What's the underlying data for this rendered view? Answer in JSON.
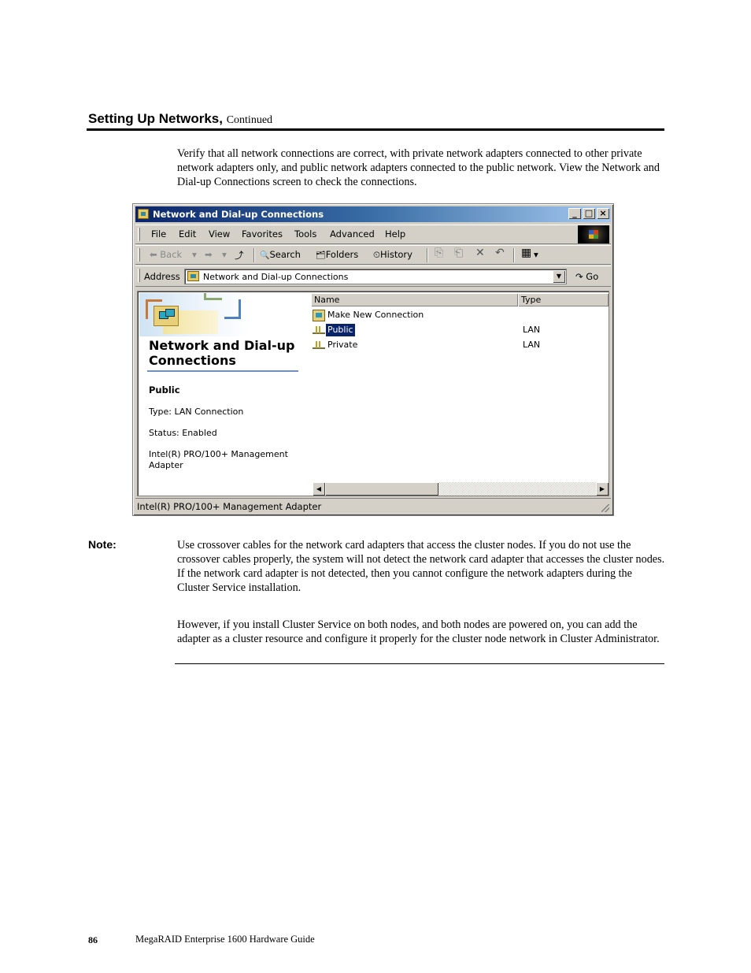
{
  "page": {
    "section_title": "Setting Up Networks,",
    "section_continued": "Continued",
    "intro_paragraph": "Verify that all network connections are correct, with private network adapters connected to other private network adapters only, and public network adapters connected to the public network. View the Network and Dial-up Connections screen to check the connections.",
    "note_label": "Note:",
    "note_paragraph_1": "Use crossover cables for the network card adapters that access the cluster nodes.  If you do not use the crossover cables properly, the system will not detect the network card adapter that accesses the cluster nodes.  If the network card adapter is not detected, then you cannot configure the network adapters during the Cluster Service installation.",
    "note_paragraph_2": "However, if you install Cluster Service on both nodes, and both nodes are powered on, you can add the adapter as a cluster resource and configure it properly for the cluster node network in Cluster Administrator.",
    "footer_page_number": "86",
    "footer_title": "MegaRAID Enterprise 1600 Hardware Guide"
  },
  "window": {
    "title": "Network and Dial-up Connections",
    "title_icon": "network-folder-icon",
    "controls": {
      "minimize": "_",
      "maximize": "□",
      "close": "×"
    },
    "menu": [
      "File",
      "Edit",
      "View",
      "Favorites",
      "Tools",
      "Advanced",
      "Help"
    ],
    "toolbar": {
      "back": "Back",
      "back_icon": "arrow-left-icon",
      "forward_icon": "arrow-right-icon",
      "up_icon": "folder-up-icon",
      "search": "Search",
      "search_icon": "magnifier-icon",
      "folders": "Folders",
      "folders_icon": "folders-icon",
      "history": "History",
      "history_icon": "clock-icon",
      "move_icon": "move-to-icon",
      "copy_icon": "copy-to-icon",
      "delete_icon": "x-icon",
      "undo_icon": "undo-icon",
      "views_icon": "views-icon",
      "dropdown_glyph": "▾",
      "back_glyph": "⬅",
      "forward_glyph": "➡",
      "up_glyph": "⤴",
      "search_glyph": "🔍",
      "folders_glyph": "🗂",
      "history_glyph": "⏲",
      "move_glyph": "⎘",
      "copy_glyph": "⎗",
      "delete_glyph": "✕",
      "undo_glyph": "↶",
      "views_glyph": "▦"
    },
    "address": {
      "label": "Address",
      "value": "Network and Dial-up Connections",
      "dropdown_glyph": "▼",
      "go_label": "Go",
      "go_glyph": "↷"
    },
    "left_pane": {
      "heading": "Network and Dial-up Connections",
      "selected_name": "Public",
      "type_line": "Type: LAN Connection",
      "status_line": "Status: Enabled",
      "adapter_line": "Intel(R) PRO/100+ Management Adapter"
    },
    "list": {
      "columns": [
        "Name",
        "Type"
      ],
      "rows": [
        {
          "name": "Make New Connection",
          "type": "",
          "icon": "make-new-connection-icon",
          "selected": false
        },
        {
          "name": "Public",
          "type": "LAN",
          "icon": "lan-connection-icon",
          "selected": true
        },
        {
          "name": "Private",
          "type": "LAN",
          "icon": "lan-connection-icon",
          "selected": false
        }
      ]
    },
    "scrollbar": {
      "left_glyph": "◀",
      "right_glyph": "▶"
    },
    "status_bar": "Intel(R) PRO/100+ Management Adapter"
  }
}
